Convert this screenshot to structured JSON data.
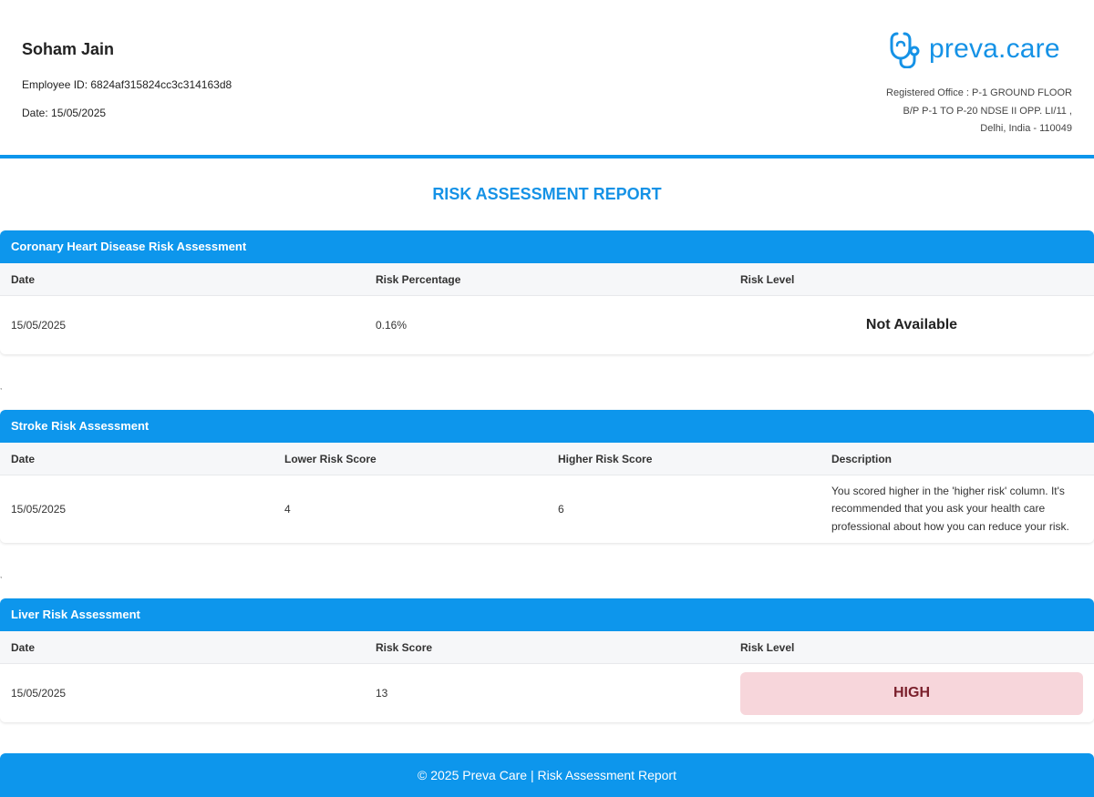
{
  "employee": {
    "name": "Soham Jain",
    "id_line": "Employee ID: 6824af315824cc3c314163d8",
    "date_line": "Date: 15/05/2025"
  },
  "brand": {
    "name": "preva.care",
    "office_line1": "Registered Office : P-1 GROUND FLOOR",
    "office_line2": "B/P P-1 TO P-20 NDSE II OPP. LI/11 ,",
    "office_line3": "Delhi, India - 110049",
    "accent_color": "#0d96ec",
    "logo_icon": "stethoscope-icon"
  },
  "report_title": "RISK ASSESSMENT REPORT",
  "separator_mark": ",",
  "coronary": {
    "title": "Coronary Heart Disease Risk Assessment",
    "headers": [
      "Date",
      "Risk Percentage",
      "Risk Level"
    ],
    "row": {
      "date": "15/05/2025",
      "percentage": "0.16%",
      "level": "Not Available"
    }
  },
  "stroke": {
    "title": "Stroke Risk Assessment",
    "headers": [
      "Date",
      "Lower Risk Score",
      "Higher Risk Score",
      "Description"
    ],
    "row": {
      "date": "15/05/2025",
      "lower": "4",
      "higher": "6",
      "description": "You scored higher in the 'higher risk' column. It's recommended that you ask your health care professional about how you can reduce your risk."
    }
  },
  "liver": {
    "title": "Liver Risk Assessment",
    "headers": [
      "Date",
      "Risk Score",
      "Risk Level"
    ],
    "row": {
      "date": "15/05/2025",
      "score": "13",
      "level": "HIGH"
    },
    "high_bg": "#f7d6db",
    "high_fg": "#7a1f2b"
  },
  "footer": {
    "text": "© 2025 Preva Care | Risk Assessment Report"
  }
}
